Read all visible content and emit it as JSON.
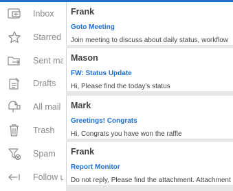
{
  "colors": {
    "accent": "#1f6fd1",
    "sidebar_label": "#8a8a8a",
    "sender": "#404040",
    "pane_background": "#e7e7e7"
  },
  "sidebar": {
    "items": [
      {
        "label": "Inbox",
        "icon": "inbox-icon"
      },
      {
        "label": "Starred",
        "icon": "star-icon"
      },
      {
        "label": "Sent mail",
        "icon": "sent-icon"
      },
      {
        "label": "Drafts",
        "icon": "drafts-icon"
      },
      {
        "label": "All mail",
        "icon": "all-mail-icon"
      },
      {
        "label": "Trash",
        "icon": "trash-icon"
      },
      {
        "label": "Spam",
        "icon": "spam-icon"
      },
      {
        "label": "Follow up",
        "icon": "follow-up-icon"
      }
    ]
  },
  "messages": [
    {
      "sender": "Frank",
      "subject": "Goto Meeting",
      "preview": "Join meeting to discuss about daily status, workflow"
    },
    {
      "sender": "Mason",
      "subject": "FW: Status Update",
      "preview": "Hi, Please find the today's status"
    },
    {
      "sender": "Mark",
      "subject": "Greetings! Congrats",
      "preview": "Hi, Congrats you have won the raffle"
    },
    {
      "sender": "Frank",
      "subject": "Report Monitor",
      "preview": "Do not reply, Please find the attachment. Attachment"
    }
  ]
}
